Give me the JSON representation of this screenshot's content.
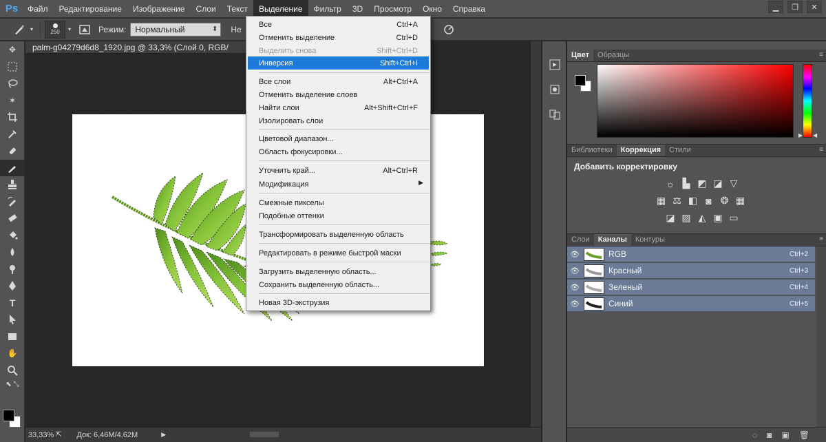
{
  "app": {
    "logo": "Ps"
  },
  "menubar": {
    "items": [
      "Файл",
      "Редактирование",
      "Изображение",
      "Слои",
      "Текст",
      "Выделение",
      "Фильтр",
      "3D",
      "Просмотр",
      "Окно",
      "Справка"
    ],
    "active_index": 5
  },
  "options": {
    "brush_size": "250",
    "mode_label": "Режим:",
    "mode_value": "Нормальный",
    "truncated_label": "Не"
  },
  "document": {
    "tab_title": "palm-g04279d6d8_1920.jpg @ 33,3% (Слой 0, RGB/"
  },
  "status": {
    "zoom": "33,33%",
    "doc_size": "Док: 6,46M/4,62M"
  },
  "selection_menu": {
    "items": [
      {
        "label": "Все",
        "shortcut": "Ctrl+A",
        "state": "normal"
      },
      {
        "label": "Отменить выделение",
        "shortcut": "Ctrl+D",
        "state": "normal"
      },
      {
        "label": "Выделить снова",
        "shortcut": "Shift+Ctrl+D",
        "state": "disabled"
      },
      {
        "label": "Инверсия",
        "shortcut": "Shift+Ctrl+I",
        "state": "highlight"
      },
      {
        "label": "Все слои",
        "shortcut": "Alt+Ctrl+A",
        "state": "normal"
      },
      {
        "label": "Отменить выделение слоев",
        "shortcut": "",
        "state": "normal"
      },
      {
        "label": "Найти слои",
        "shortcut": "Alt+Shift+Ctrl+F",
        "state": "normal"
      },
      {
        "label": "Изолировать слои",
        "shortcut": "",
        "state": "normal"
      },
      {
        "label": "Цветовой диапазон...",
        "shortcut": "",
        "state": "normal"
      },
      {
        "label": "Область фокусировки...",
        "shortcut": "",
        "state": "normal"
      },
      {
        "label": "Уточнить край...",
        "shortcut": "Alt+Ctrl+R",
        "state": "normal"
      },
      {
        "label": "Модификация",
        "shortcut": "",
        "state": "submenu"
      },
      {
        "label": "Смежные пикселы",
        "shortcut": "",
        "state": "normal"
      },
      {
        "label": "Подобные оттенки",
        "shortcut": "",
        "state": "normal"
      },
      {
        "label": "Трансформировать выделенную область",
        "shortcut": "",
        "state": "normal"
      },
      {
        "label": "Редактировать в режиме быстрой маски",
        "shortcut": "",
        "state": "normal"
      },
      {
        "label": "Загрузить выделенную область...",
        "shortcut": "",
        "state": "normal"
      },
      {
        "label": "Сохранить выделенную область...",
        "shortcut": "",
        "state": "normal"
      },
      {
        "label": "Новая 3D-экструзия",
        "shortcut": "",
        "state": "normal"
      }
    ]
  },
  "color_panel": {
    "tabs": [
      "Цвет",
      "Образцы"
    ],
    "fg_color": "#000000",
    "bg_color": "#ffffff",
    "hue_color": "#ff0000"
  },
  "adjustments_panel": {
    "tabs": [
      "Библиотеки",
      "Коррекция",
      "Стили"
    ],
    "active_tab": 1,
    "title": "Добавить корректировку",
    "icons": [
      [
        "brightness-icon",
        "levels-icon",
        "curves-icon",
        "exposure-icon",
        "vibrance-icon"
      ],
      [
        "hue-saturation-icon",
        "color-balance-icon",
        "black-white-icon",
        "photo-filter-icon",
        "channel-mixer-icon",
        "color-lookup-icon"
      ],
      [
        "invert-icon",
        "posterize-icon",
        "threshold-icon",
        "selective-color-icon",
        "gradient-map-icon"
      ]
    ]
  },
  "channels_panel": {
    "tabs": [
      "Слои",
      "Каналы",
      "Контуры"
    ],
    "active_tab": 1,
    "channels": [
      {
        "name": "RGB",
        "shortcut": "Ctrl+2"
      },
      {
        "name": "Красный",
        "shortcut": "Ctrl+3"
      },
      {
        "name": "Зеленый",
        "shortcut": "Ctrl+4"
      },
      {
        "name": "Синий",
        "shortcut": "Ctrl+5"
      }
    ]
  },
  "theme": {
    "accent": "#1c7ad8",
    "channel_row": "#6b7b96",
    "leaf_green": "#7cb82f"
  }
}
